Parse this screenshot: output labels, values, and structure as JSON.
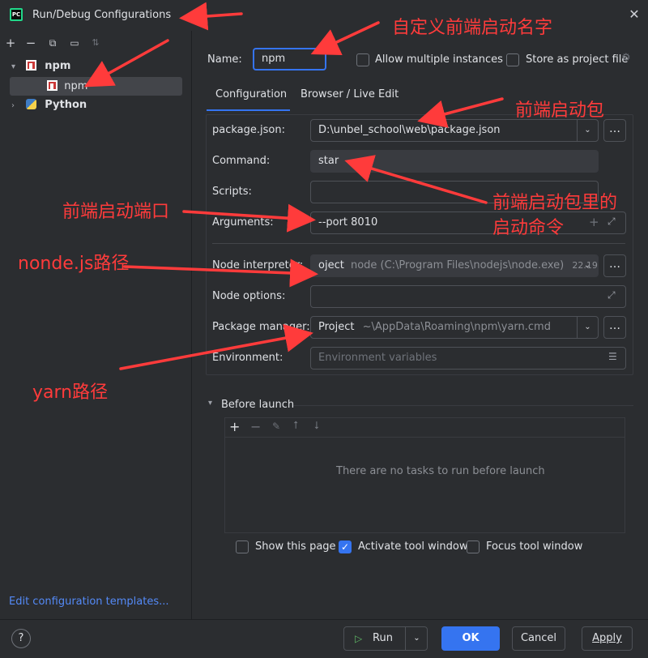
{
  "window": {
    "title": "Run/Debug Configurations"
  },
  "tree": {
    "items": [
      {
        "label": "npm"
      },
      {
        "label": "npm"
      },
      {
        "label": "Python"
      }
    ]
  },
  "left_footer": {
    "link": "Edit configuration templates..."
  },
  "header": {
    "name_label": "Name:",
    "name_value": "npm",
    "allow_multiple_label": "Allow multiple instances",
    "store_project_label": "Store as project file"
  },
  "tabs": [
    {
      "label": "Configuration"
    },
    {
      "label": "Browser / Live Edit"
    }
  ],
  "config": {
    "package_json_label": "package.json:",
    "package_json_value": "D:\\unbel_school\\web\\package.json",
    "command_label": "Command:",
    "command_value": "star",
    "scripts_label": "Scripts:",
    "arguments_label": "Arguments:",
    "arguments_value": "--port 8010",
    "node_interpreter_label": "Node interpreter:",
    "node_interpreter_prefix": "oject",
    "node_interpreter_path": "node (C:\\Program Files\\nodejs\\node.exe)",
    "node_interpreter_version": "22.19.0",
    "node_options_label": "Node options:",
    "package_manager_label": "Package manager:",
    "package_manager_prefix": "Project",
    "package_manager_path": "~\\AppData\\Roaming\\npm\\yarn.cmd",
    "environment_label": "Environment:",
    "environment_placeholder": "Environment variables"
  },
  "before_launch": {
    "title": "Before launch",
    "empty_text": "There are no tasks to run before launch"
  },
  "options": {
    "show_page_label": "Show this page",
    "activate_tool_label": "Activate tool window",
    "focus_tool_label": "Focus tool window"
  },
  "buttons": {
    "help": "?",
    "run": "Run",
    "ok": "OK",
    "cancel": "Cancel",
    "apply": "Apply"
  },
  "annotations": {
    "custom_name": "自定义前端启动名字",
    "frontend_package": "前端启动包",
    "frontend_port": "前端启动端口",
    "package_command_line1": "前端启动包里的",
    "package_command_line2": "启动命令",
    "node_path": "nonde.js路径",
    "yarn_path": "yarn路径"
  },
  "colors": {
    "accent": "#3574f0",
    "annotation": "#ff3b3b",
    "background": "#2b2d30"
  }
}
